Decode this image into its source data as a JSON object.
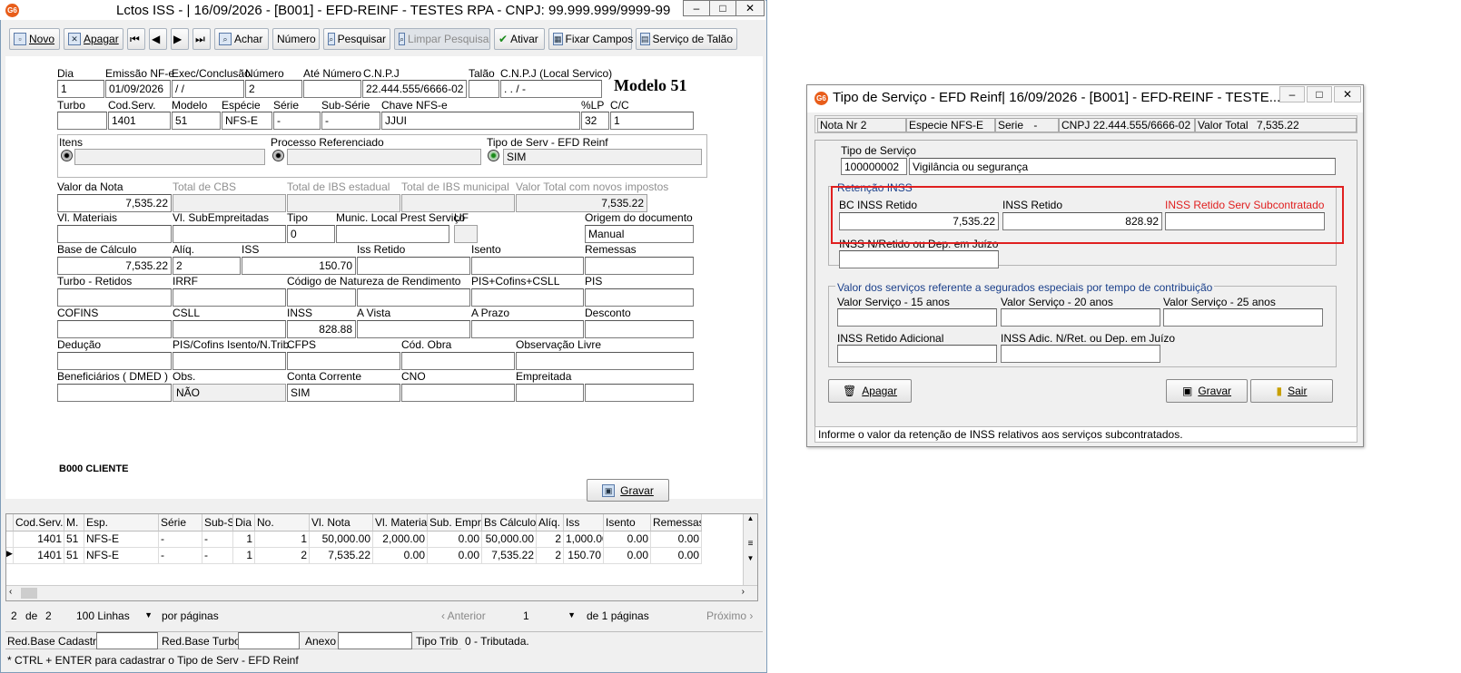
{
  "main": {
    "title": "Lctos ISS - |  16/09/2026 - [B001] - EFD-REINF - TESTES RPA - CNPJ: 99.999.999/9999-99",
    "app_badge": "G6",
    "toolbar": {
      "novo": "Novo",
      "apagar": "Apagar",
      "achar": "Achar",
      "numero": "Número",
      "pesquisar": "Pesquisar",
      "limpar": "Limpar Pesquisa",
      "ativar": "Ativar",
      "fixar": "Fixar Campos",
      "servico": "Serviço de Talão"
    },
    "modelo_title": "Modelo 51",
    "labels": {
      "dia": "Dia",
      "emissao": "Emissão NF-e",
      "exec": "Exec/Conclusão",
      "numero": "Número",
      "ate_numero": "Até Número",
      "cnpj": "C.N.P.J",
      "talao": "Talão",
      "cnpj_local": "C.N.P.J (Local Servico)",
      "turbo": "Turbo",
      "cod_serv": "Cod.Serv.",
      "modelo": "Modelo",
      "especie": "Espécie",
      "serie": "Série",
      "sub_serie": "Sub-Série",
      "chave": "Chave NFS-e",
      "lp": "%LP",
      "cc": "C/C",
      "itens": "Itens",
      "processo": "Processo Referenciado",
      "tipo_serv": "Tipo de Serv - EFD Reinf",
      "valor_nota": "Valor da Nota",
      "total_cbs": "Total de CBS",
      "total_ibs_est": "Total de IBS estadual",
      "total_ibs_mun": "Total de IBS municipal",
      "valor_total_novos": "Valor Total com novos impostos",
      "vl_materiais": "Vl. Materiais",
      "vl_subemp": "Vl. SubEmpreitadas",
      "tipo": "Tipo",
      "munic": "Munic. Local Prest Serviço",
      "uf": "UF",
      "origem": "Origem do documento",
      "base_calculo": "Base de Cálculo",
      "aliq": "Alíq.",
      "iss": "ISS",
      "iss_retido": "Iss Retido",
      "isento": "Isento",
      "remessas": "Remessas",
      "turbo_retidos": "Turbo - Retidos",
      "irrf": "IRRF",
      "cod_natureza": "Código de Natureza de Rendimento",
      "pis_cofins_csll": "PIS+Cofins+CSLL",
      "pis": "PIS",
      "cofins": "COFINS",
      "csll": "CSLL",
      "inss": "INSS",
      "a_vista": "A Vista",
      "a_prazo": "A Prazo",
      "desconto": "Desconto",
      "deducao": "Dedução",
      "pis_cofins_isento": "PIS/Cofins Isento/N.Trib.",
      "cfps": "CFPS",
      "cod_obra": "Cód. Obra",
      "obs_livre": "Observação Livre",
      "beneficiarios": "Beneficiários ( DMED )",
      "obs": "Obs.",
      "conta_corrente": "Conta Corrente",
      "cno": "CNO",
      "empreitada": "Empreitada"
    },
    "values": {
      "dia": "1",
      "emissao": "01/09/2026",
      "exec": " / /",
      "numero": "2",
      "cnpj": "22.444.555/6666-02",
      "cnpj_local": " .  .  /  -",
      "cod_serv": "1401",
      "modelo": "51",
      "especie": "NFS-E",
      "serie": "-",
      "sub_serie": "-",
      "chave": "JJUI",
      "lp": "32",
      "cc": "1",
      "tipo_serv": "SIM",
      "valor_nota": "7,535.22",
      "valor_total_novos": "7,535.22",
      "tipo": "0",
      "origem": "Manual",
      "base_calculo": "7,535.22",
      "aliq": "2",
      "iss": "150.70",
      "inss": "828.88",
      "obs": "NÃO",
      "conta_corrente": "SIM"
    },
    "cliente": "B000 CLIENTE",
    "gravar": "Gravar",
    "grid": {
      "headers": [
        "Cod.Serv.",
        "M.",
        "Esp.",
        "Série",
        "Sub-S",
        "Dia",
        "No.",
        "Vl. Nota",
        "Vl. Materiais",
        "Sub. Empr",
        "Bs Cálculo",
        "Alíq.",
        "Iss",
        "Isento",
        "Remessas"
      ],
      "rows": [
        [
          "1401",
          "51",
          "NFS-E",
          "-",
          "-",
          "1",
          "1",
          "50,000.00",
          "2,000.00",
          "0.00",
          "50,000.00",
          "2",
          "1,000.00",
          "0.00",
          "0.00"
        ],
        [
          "1401",
          "51",
          "NFS-E",
          "-",
          "-",
          "1",
          "2",
          "7,535.22",
          "0.00",
          "0.00",
          "7,535.22",
          "2",
          "150.70",
          "0.00",
          "0.00"
        ]
      ]
    },
    "pager": {
      "count": "2",
      "de": "de",
      "total": "2",
      "linhas": "100 Linhas",
      "por_paginas": "por páginas",
      "anterior": "Anterior",
      "page": "1",
      "de_paginas": "de 1 páginas",
      "proximo": "Próximo"
    },
    "statusrow": {
      "red_base_cadastro": "Red.Base Cadastro",
      "red_base_turbo": "Red.Base Turbo",
      "anexo": "Anexo",
      "tipo_trib": "Tipo Trib",
      "tipo_trib_value": "0  - Tributada."
    },
    "hint": "* CTRL + ENTER para  cadastrar o Tipo de Serv - EFD Reinf"
  },
  "dialog": {
    "title": "Tipo de Serviço - EFD Reinf|  16/09/2026 - [B001] - EFD-REINF - TESTE...",
    "info": {
      "nota_label": "Nota Nr",
      "nota": "2",
      "especie_label": "Especie",
      "especie": "NFS-E",
      "serie_label": "Serie",
      "serie": "-",
      "cnpj_label": "CNPJ",
      "cnpj": "22.444.555/6666-02",
      "valor_total_label": "Valor Total",
      "valor_total": "7,535.22"
    },
    "tipo_servico_label": "Tipo de Serviço",
    "tipo_servico_code": "100000002",
    "tipo_servico_desc": "Vigilância ou segurança",
    "retencao_title": "Retenção INSS",
    "bc_inss_label": "BC INSS Retido",
    "bc_inss": "7,535.22",
    "inss_retido_label": "INSS Retido",
    "inss_retido": "828.92",
    "inss_sub_label": "INSS Retido Serv Subcontratado",
    "inss_nret_label": "INSS N/Retido ou Dep. em Juízo",
    "valor_servicos_title": "Valor dos serviços referente a segurados especiais por tempo de contribuição",
    "vs15": "Valor Serviço - 15 anos",
    "vs20": "Valor Serviço - 20 anos",
    "vs25": "Valor Serviço - 25 anos",
    "inss_adicional": "INSS Retido Adicional",
    "inss_adic_nret": "INSS Adic. N/Ret. ou Dep. em Juízo",
    "apagar": "Apagar",
    "gravar": "Gravar",
    "sair": "Sair",
    "status": "Informe o valor da retenção de INSS relativos aos serviços subcontratados."
  },
  "colors": {
    "accent_red": "#e02020",
    "group_title": "#1a3f8a",
    "app_orange": "#e85d1a"
  }
}
